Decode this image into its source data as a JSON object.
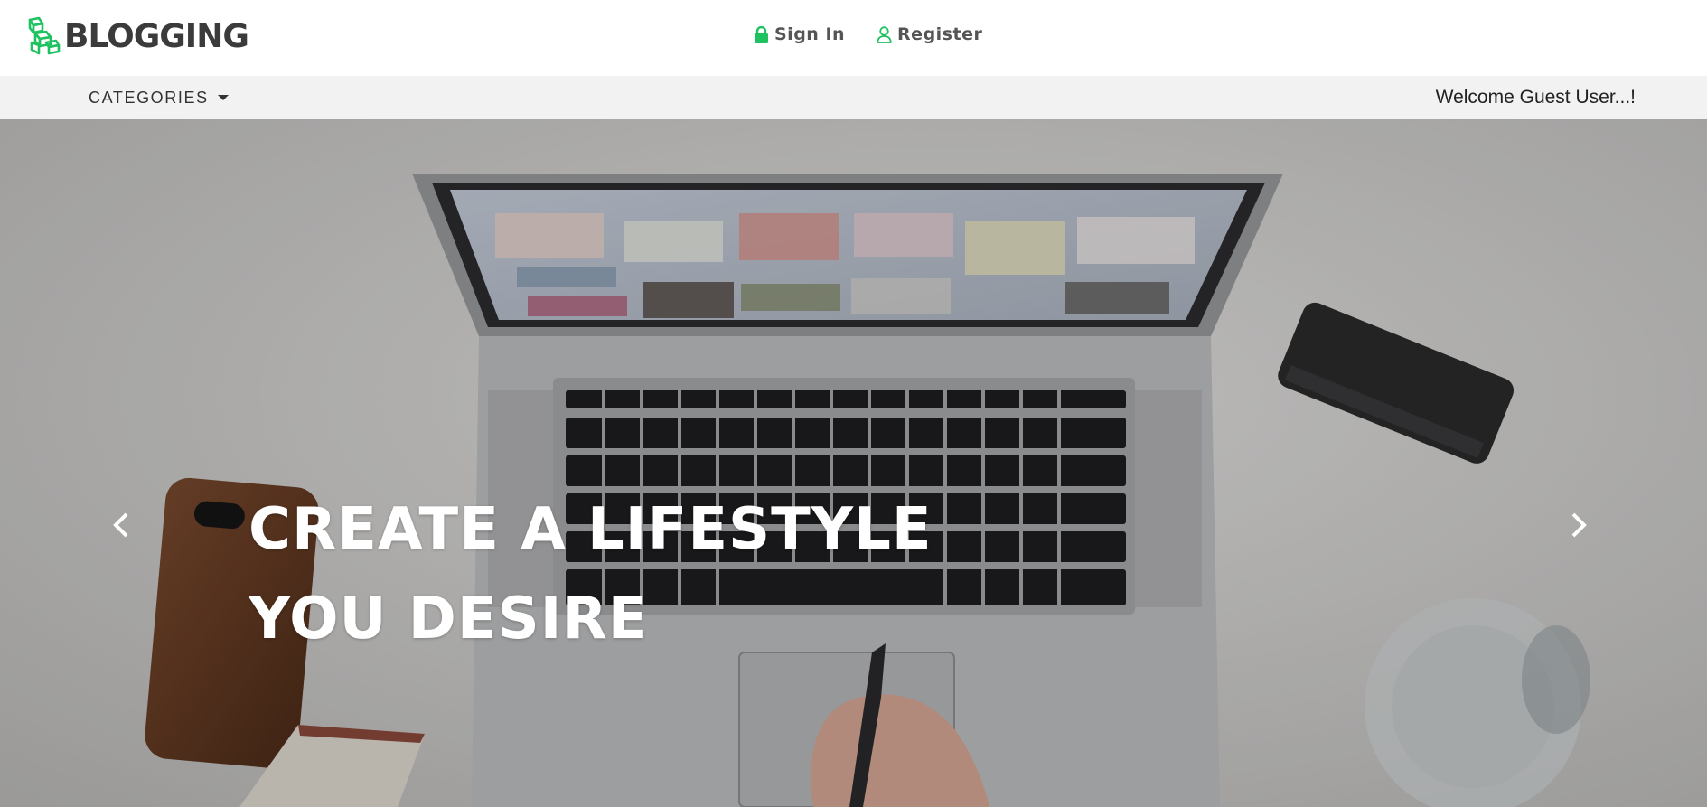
{
  "header": {
    "logo_text": "BLOGGING",
    "nav": {
      "sign_in": "Sign In",
      "register": "Register"
    }
  },
  "category_bar": {
    "categories_label": "CATEGORIES",
    "welcome_text": "Welcome Guest User...!"
  },
  "hero": {
    "title_line1": "CREATE A LIFESTYLE",
    "title_line2": "YOU DESIRE"
  },
  "icons": {
    "logo": "blocks-logo-icon",
    "sign_in": "lock-icon",
    "register": "user-icon",
    "categories": "caret-down-icon",
    "prev": "chevron-left-icon",
    "next": "chevron-right-icon"
  },
  "colors": {
    "brand_green": "#1fc261",
    "header_bg": "#ffffff",
    "category_bar_bg": "#f1f2f1",
    "text_dark": "#3b3b3b"
  }
}
